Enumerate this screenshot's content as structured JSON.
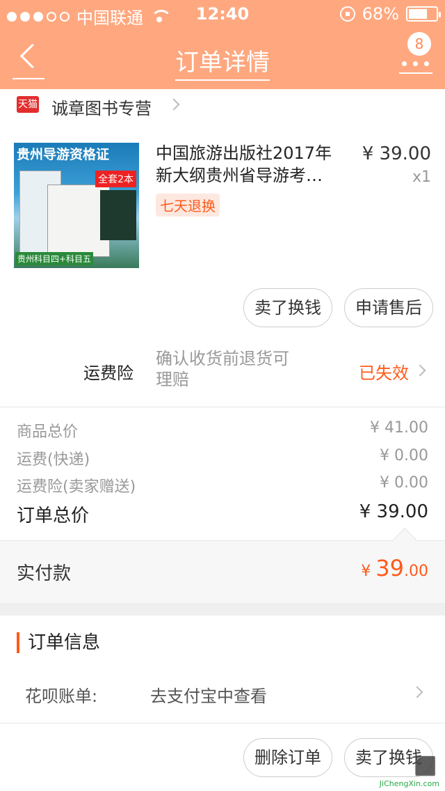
{
  "status_bar": {
    "carrier": "中国联通",
    "time": "12:40",
    "battery": "68%",
    "battery_level": 0.68
  },
  "nav": {
    "title": "订单详情",
    "badge": "8"
  },
  "shop": {
    "platform_badge": "天猫",
    "name": "诚章图书专营"
  },
  "product": {
    "cover_text_title": "贵州导游资格证",
    "cover_text_set": "全套2本",
    "cover_text_bottom": "贵州科目四+科目五",
    "name_line1": "中国旅游出版社2017年",
    "name_line2": "新大纲贵州省导游考…",
    "price": "¥ 39.00",
    "quantity": "x1",
    "tag": "七天退换"
  },
  "item_actions": {
    "sell": "卖了换钱",
    "after_sale": "申请售后"
  },
  "shipping_insurance": {
    "label": "运费险",
    "description_line1": "确认收货前退货可",
    "description_line2": "理赔",
    "status": "已失效"
  },
  "summary": {
    "rows": [
      {
        "label": "商品总价",
        "value": "¥ 41.00"
      },
      {
        "label": "运费(快递)",
        "value": "¥ 0.00"
      },
      {
        "label": "运费险(卖家赠送)",
        "value": "¥ 0.00"
      }
    ],
    "total_label": "订单总价",
    "total_value": "¥ 39.00"
  },
  "paid": {
    "label": "实付款",
    "currency": "¥ ",
    "integer": "39",
    "decimal": ".00"
  },
  "order_info": {
    "title": "订单信息",
    "huabei_label": "花呗账单:",
    "huabei_link": "去支付宝中查看"
  },
  "bottom_actions": {
    "delete": "删除订单",
    "sell": "卖了换钱"
  },
  "watermark": {
    "text": "JiChengXin.com"
  },
  "colors": {
    "header": "#ffa880",
    "accent": "#ff5a1a",
    "tmall_red": "#e32d2d"
  }
}
